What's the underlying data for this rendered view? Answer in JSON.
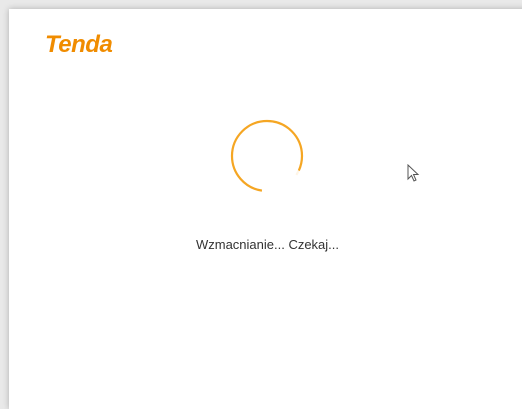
{
  "brand": {
    "name": "Tenda",
    "color": "#f08c00"
  },
  "loader": {
    "accent_color": "#f5a623",
    "message": "Wzmacnianie... Czekaj..."
  },
  "cursor": {
    "icon": "mouse-pointer-icon"
  }
}
